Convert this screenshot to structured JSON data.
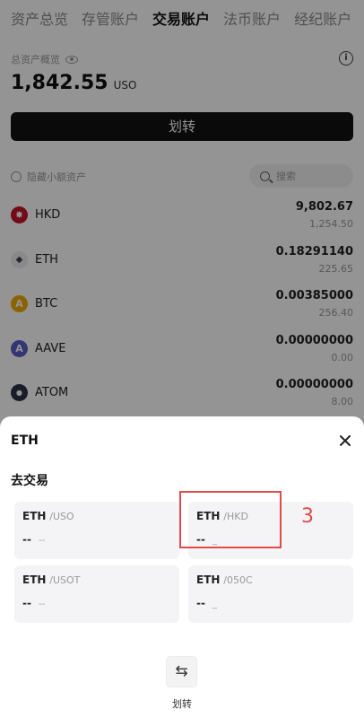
{
  "tabs": [
    "资产总览",
    "存管账户",
    "交易账户",
    "法币账户",
    "经纪账户"
  ],
  "active_tab": "交易账户",
  "assets": {
    "label": "总资产概览",
    "balance": "1,842.55",
    "unit": "USO"
  },
  "transfer_button": "划转",
  "hide_small_label": "隐藏小额资产",
  "search_placeholder": "搜索",
  "coins": [
    {
      "name": "HKD",
      "amount": "9,802.67",
      "value": "1,254.50",
      "icon": "hk-flag-icon",
      "color": "#c8102e",
      "symbol": "✸"
    },
    {
      "name": "ETH",
      "amount": "0.18291140",
      "value": "225.65",
      "icon": "eth-icon",
      "color": "#e8e8ee",
      "symbol": "◆"
    },
    {
      "name": "BTC",
      "amount": "0.00385000",
      "value": "256.40",
      "icon": "btc-icon",
      "color": "#f2a900",
      "symbol": "A"
    },
    {
      "name": "AAVE",
      "amount": "0.00000000",
      "value": "0.00",
      "icon": "aave-icon",
      "color": "#5a5ec9",
      "symbol": "A"
    },
    {
      "name": "ATOM",
      "amount": "0.00000000",
      "value": "8.00",
      "icon": "atom-icon",
      "color": "#2e3148",
      "symbol": "●"
    }
  ],
  "sheet": {
    "title": "ETH",
    "section": "去交易",
    "pairs": [
      {
        "base": "ETH",
        "quote": "/USO",
        "price": "--",
        "change": "--"
      },
      {
        "base": "ETH",
        "quote": "/HKD",
        "price": "--",
        "change": "_"
      },
      {
        "base": "ETH",
        "quote": "/USOT",
        "price": "--",
        "change": "--"
      },
      {
        "base": "ETH",
        "quote": "/050C",
        "price": "--",
        "change": "_"
      }
    ],
    "transfer_label": "划转"
  },
  "annotation": "3",
  "colors": {
    "accent_red": "#e04a4a",
    "primary_button": "#121212",
    "card_bg": "#f4f4f7"
  }
}
